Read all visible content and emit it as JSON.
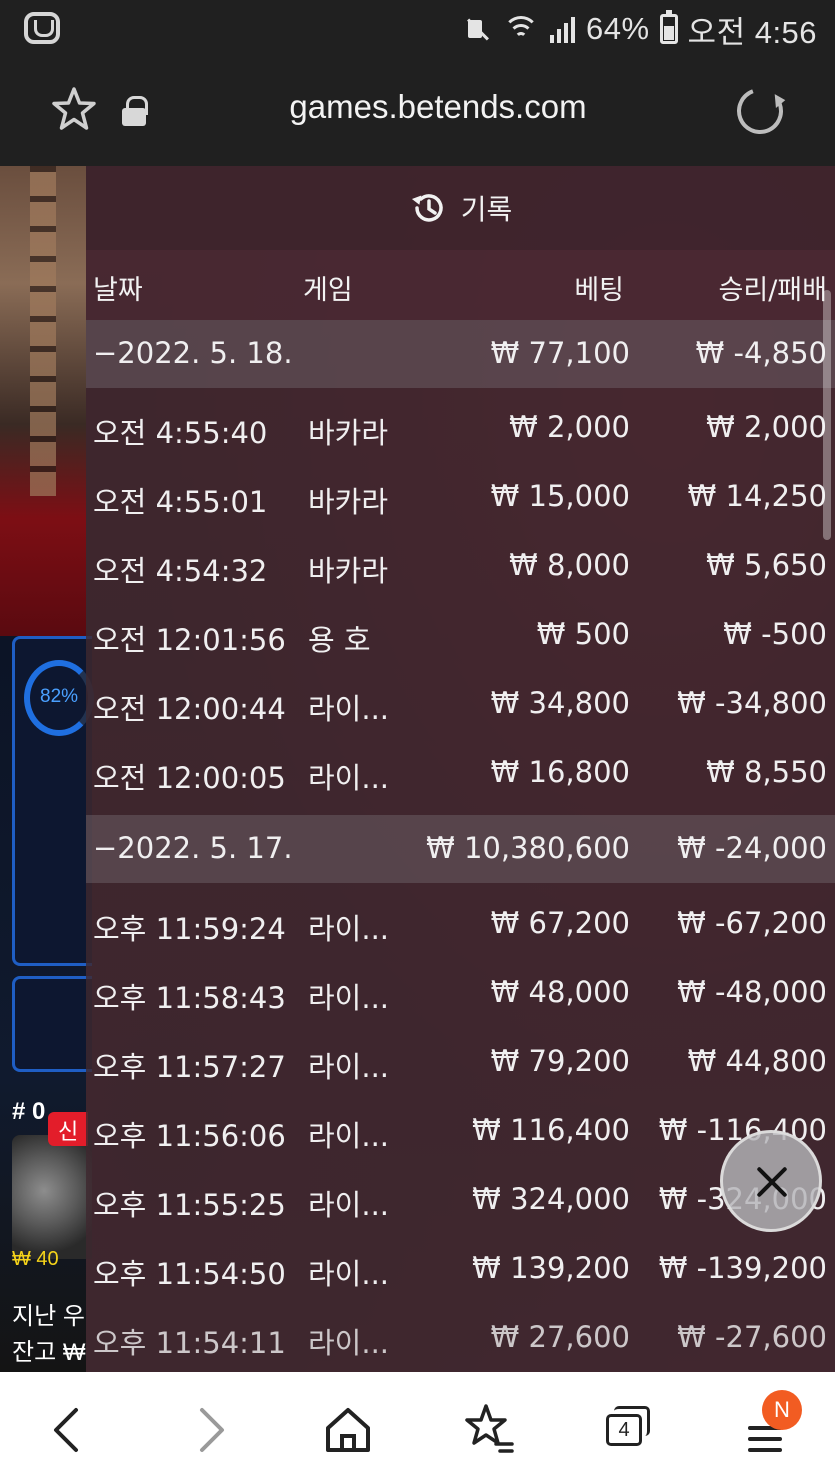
{
  "status_bar": {
    "battery": "64%",
    "time": "오전 4:56",
    "icons": [
      "app-icon",
      "mute-icon",
      "wifi-icon",
      "signal-icon",
      "battery-icon"
    ]
  },
  "browser": {
    "url": "games.betends.com",
    "icons": [
      "star-icon",
      "lock-icon",
      "reload-icon"
    ]
  },
  "background": {
    "gauge_percent": "82%",
    "hash_label": "# 0",
    "badge_label": "신",
    "chip_amount": "₩ 40",
    "last_win_label": "지난 우",
    "balance_label": "잔고 ₩"
  },
  "history": {
    "title": "기록",
    "title_icon": "history-clock-icon",
    "columns": {
      "date": "날짜",
      "game": "게임",
      "bet": "베팅",
      "result": "승리/패배"
    },
    "days": [
      {
        "date": "−2022. 5. 18.",
        "bet_total": "₩ 77,100",
        "result_total": "₩ -4,850",
        "rows": [
          {
            "time": "오전 4:55:40",
            "game": "바카라",
            "bet": "₩ 2,000",
            "result": "₩ 2,000"
          },
          {
            "time": "오전 4:55:01",
            "game": "바카라",
            "bet": "₩ 15,000",
            "result": "₩ 14,250"
          },
          {
            "time": "오전 4:54:32",
            "game": "바카라",
            "bet": "₩ 8,000",
            "result": "₩ 5,650"
          },
          {
            "time": "오전 12:01:56",
            "game": "용 호",
            "bet": "₩ 500",
            "result": "₩ -500"
          },
          {
            "time": "오전 12:00:44",
            "game": "라이...",
            "bet": "₩ 34,800",
            "result": "₩ -34,800"
          },
          {
            "time": "오전 12:00:05",
            "game": "라이...",
            "bet": "₩ 16,800",
            "result": "₩ 8,550"
          }
        ]
      },
      {
        "date": "−2022. 5. 17.",
        "bet_total": "₩ 10,380,600",
        "result_total": "₩ -24,000",
        "rows": [
          {
            "time": "오후 11:59:24",
            "game": "라이...",
            "bet": "₩ 67,200",
            "result": "₩ -67,200"
          },
          {
            "time": "오후 11:58:43",
            "game": "라이...",
            "bet": "₩ 48,000",
            "result": "₩ -48,000"
          },
          {
            "time": "오후 11:57:27",
            "game": "라이...",
            "bet": "₩ 79,200",
            "result": "₩ 44,800"
          },
          {
            "time": "오후 11:56:06",
            "game": "라이...",
            "bet": "₩ 116,400",
            "result": "₩ -116,400"
          },
          {
            "time": "오후 11:55:25",
            "game": "라이...",
            "bet": "₩ 324,000",
            "result": "₩ -324,000"
          },
          {
            "time": "오후 11:54:50",
            "game": "라이...",
            "bet": "₩ 139,200",
            "result": "₩ -139,200"
          },
          {
            "time": "오후 11:54:11",
            "game": "라이...",
            "bet": "₩ 27,600",
            "result": "₩ -27,600"
          }
        ]
      }
    ]
  },
  "close_button": {
    "icon": "close-icon"
  },
  "bottom_nav": {
    "tab_count": "4",
    "notification_badge": "N",
    "icons": [
      "back-arrow-icon",
      "forward-arrow-icon",
      "home-icon",
      "bookmarks-icon",
      "tabs-icon",
      "menu-icon"
    ]
  },
  "colors": {
    "panel_bg": "#3e2830",
    "date_row_bg": "#786e74",
    "status_bar_bg": "#202020",
    "badge_orange": "#f25c22"
  }
}
